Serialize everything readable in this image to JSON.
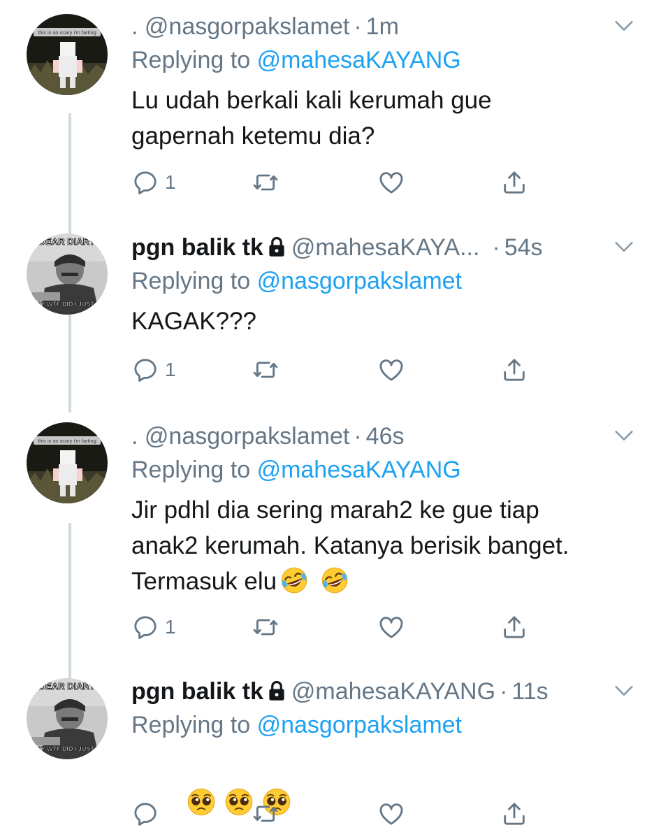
{
  "tweets": [
    {
      "name": "",
      "handle": ". @nasgorpakslamet",
      "time": "1m",
      "replying_prefix": "Replying to",
      "replying_to": "@mahesaKAYANG",
      "text": "Lu udah berkali kali kerumah gue\ngapernah ketemu dia?",
      "emojis": [],
      "reply_count": "1",
      "avatar_caption": "this is so scary i'm farting",
      "avatar_type": "ghost"
    },
    {
      "name": "pgn balik tk",
      "handle": "@mahesaKAYA...",
      "time": "54s",
      "replying_prefix": "Replying to",
      "replying_to": "@nasgorpakslamet",
      "text": "KAGAK???",
      "emojis": [],
      "reply_count": "1",
      "avatar_top": "DEAR DIARY",
      "avatar_bottom": "TODAY WTF DID I JUST SAW",
      "avatar_type": "diary"
    },
    {
      "name": "",
      "handle": ". @nasgorpakslamet",
      "time": "46s",
      "replying_prefix": "Replying to",
      "replying_to": "@mahesaKAYANG",
      "text": "Jir pdhl dia sering marah2 ke gue tiap\nanak2 kerumah. Katanya berisik banget.\nTermasuk elu",
      "emojis": [
        "rofl-emoji",
        "rofl-emoji"
      ],
      "reply_count": "1",
      "avatar_caption": "this is so scary i'm farting",
      "avatar_type": "ghost"
    },
    {
      "name": "pgn balik tk",
      "handle": "@mahesaKAYANG",
      "time": "11s",
      "replying_prefix": "Replying to",
      "replying_to": "@nasgorpakslamet",
      "text": "",
      "emojis": [
        "pleading-face-emoji",
        "pleading-face-emoji",
        "pleading-face-emoji"
      ],
      "reply_count": "",
      "avatar_top": "DEAR DIARY",
      "avatar_bottom": "TODAY WTF DID I JUST SAW",
      "avatar_type": "diary"
    }
  ],
  "colors": {
    "text": "#14171a",
    "secondary": "#657786",
    "link": "#1da1f2",
    "thread_line": "#cfd9de"
  },
  "icons": [
    "reply-icon",
    "retweet-icon",
    "like-icon",
    "share-icon",
    "chevron-down-icon",
    "lock-icon"
  ]
}
